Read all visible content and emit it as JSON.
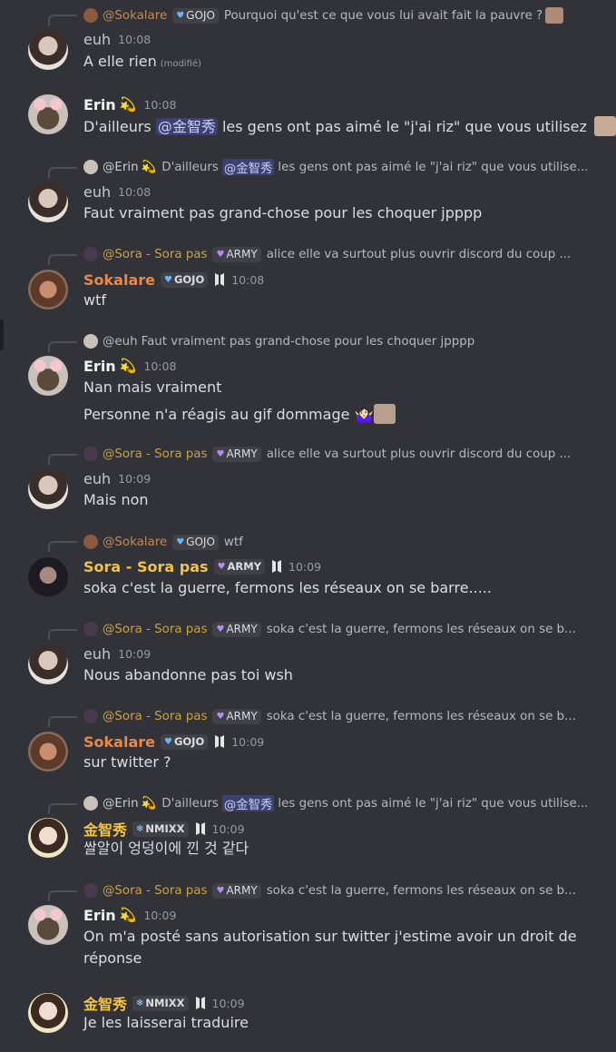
{
  "colors": {
    "background": "#313338",
    "text": "#dbdee1",
    "muted": "#949ba4",
    "mention_bg": "#3c4270",
    "mention_fg": "#c9cdfb",
    "sokalare": "#e8894a",
    "sora": "#f0c24b",
    "jisoo": "#f5c542"
  },
  "messages": [
    {
      "reply": {
        "name": "@Sokalare",
        "tag": "GOJO",
        "tag_icon": "blue-heart",
        "text": "Pourquoi qu'est ce que vous lui avait fait la pauvre ?"
      },
      "author": "euh",
      "time": "10:08",
      "content": "A elle rien",
      "edited": "(modifié)"
    },
    {
      "author": "Erin",
      "author_emoji": "💫",
      "time": "10:08",
      "content_before": "D'ailleurs",
      "mention": "@金智秀",
      "content_after": "les gens ont pas aimé le \"j'ai riz\" que vous utilisez"
    },
    {
      "reply": {
        "name": "@Erin",
        "name_emoji": "💫",
        "text_before": "D'ailleurs",
        "mention": "@金智秀",
        "text_after": "les gens ont pas aimé le \"j'ai riz\" que vous utilise..."
      },
      "author": "euh",
      "time": "10:08",
      "content": "Faut vraiment pas grand-chose pour les choquer jpppp"
    },
    {
      "reply": {
        "name": "@Sora - Sora pas",
        "tag": "ARMY",
        "tag_icon": "purple-heart",
        "text": "alice elle va surtout plus ouvrir discord du coup ..."
      },
      "author": "Sokalare",
      "tag": "GOJO",
      "tag_icon": "blue-heart",
      "time": "10:08",
      "content": "wtf"
    },
    {
      "reply": {
        "name": "@euh",
        "text": "Faut vraiment pas grand-chose pour les choquer jpppp"
      },
      "author": "Erin",
      "author_emoji": "💫",
      "time": "10:08",
      "content": "Nan mais vraiment",
      "content2": "Personne n'a réagis au gif dommage",
      "content2_emoji": "🤷🏻‍♀️"
    },
    {
      "reply": {
        "name": "@Sora - Sora pas",
        "tag": "ARMY",
        "tag_icon": "purple-heart",
        "text": "alice elle va surtout plus ouvrir discord du coup ..."
      },
      "author": "euh",
      "time": "10:09",
      "content": "Mais non"
    },
    {
      "reply": {
        "name": "@Sokalare",
        "tag": "GOJO",
        "tag_icon": "blue-heart",
        "text": "wtf"
      },
      "author": "Sora - Sora pas",
      "tag": "ARMY",
      "tag_icon": "purple-heart",
      "time": "10:09",
      "content": "soka c'est la guerre, fermons les réseaux on se barre....."
    },
    {
      "reply": {
        "name": "@Sora - Sora pas",
        "tag": "ARMY",
        "tag_icon": "purple-heart",
        "text": "soka c'est la guerre, fermons les réseaux on se b..."
      },
      "author": "euh",
      "time": "10:09",
      "content": "Nous abandonne pas toi wsh"
    },
    {
      "reply": {
        "name": "@Sora - Sora pas",
        "tag": "ARMY",
        "tag_icon": "purple-heart",
        "text": "soka c'est la guerre, fermons les réseaux on se b..."
      },
      "author": "Sokalare",
      "tag": "GOJO",
      "tag_icon": "blue-heart",
      "time": "10:09",
      "content": "sur twitter ?"
    },
    {
      "reply": {
        "name": "@Erin",
        "name_emoji": "💫",
        "text_before": "D'ailleurs",
        "mention": "@金智秀",
        "text_after": "les gens ont pas aimé le \"j'ai riz\" que vous utilise..."
      },
      "author": "金智秀",
      "tag": "NMIXX",
      "tag_icon": "ice",
      "time": "10:09",
      "content": "쌀알이 엉덩이에 낀 것 같다"
    },
    {
      "reply": {
        "name": "@Sora - Sora pas",
        "tag": "ARMY",
        "tag_icon": "purple-heart",
        "text": "soka c'est la guerre, fermons les réseaux on se b..."
      },
      "author": "Erin",
      "author_emoji": "💫",
      "time": "10:09",
      "content": "On m'a posté sans autorisation sur twitter j'estime avoir un droit de",
      "content2": "réponse"
    },
    {
      "author": "金智秀",
      "tag": "NMIXX",
      "tag_icon": "ice",
      "time": "10:09",
      "content": "Je les laisserai traduire"
    }
  ]
}
